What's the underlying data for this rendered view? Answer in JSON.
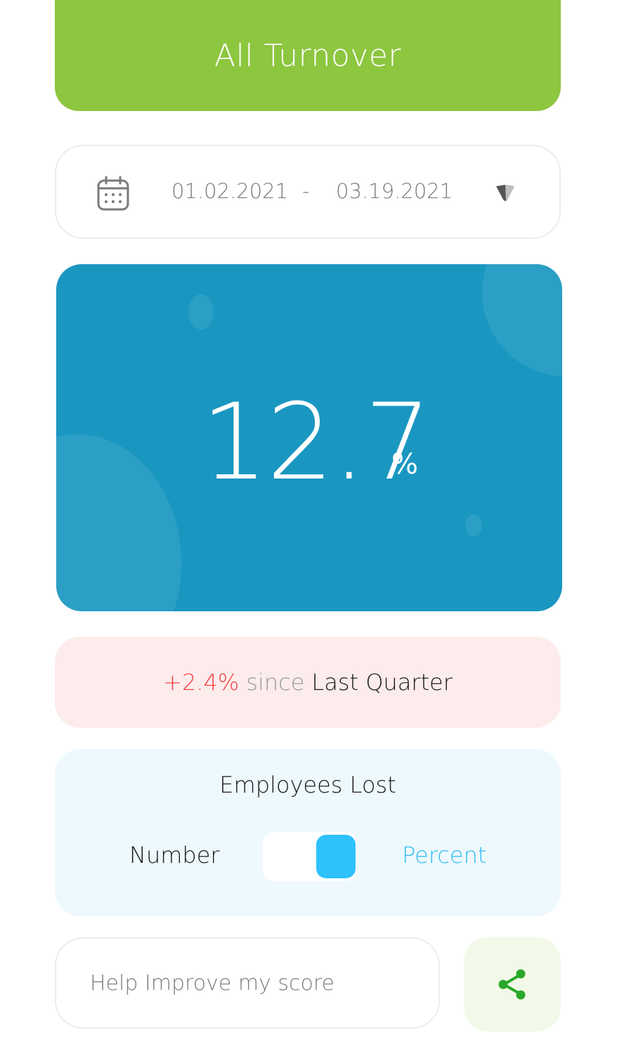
{
  "header": {
    "title": "All Turnover"
  },
  "date_range": {
    "calendar_icon": "calendar-icon",
    "start": "01.02.2021",
    "separator": "-",
    "end": "03.19.2021",
    "dropdown_icon": "chevron-down-icon"
  },
  "metric": {
    "value": "12.7",
    "unit": "%"
  },
  "change": {
    "delta": "+2.4%",
    "since_label": "since",
    "period": "Last Quarter"
  },
  "employees": {
    "title": "Employees Lost",
    "option_number": "Number",
    "option_percent": "Percent",
    "selected": "Percent"
  },
  "feedback": {
    "placeholder": "Help Improve my score"
  },
  "share": {
    "icon": "share-icon"
  },
  "colors": {
    "header_bg": "#8dc63f",
    "metric_card_bg": "#1a97c1",
    "change_bg": "#fdecec",
    "delta_red": "#f04545",
    "employees_bg": "#eef9fd",
    "toggle_accent": "#2ec1fc",
    "share_green": "#2aa82a"
  }
}
